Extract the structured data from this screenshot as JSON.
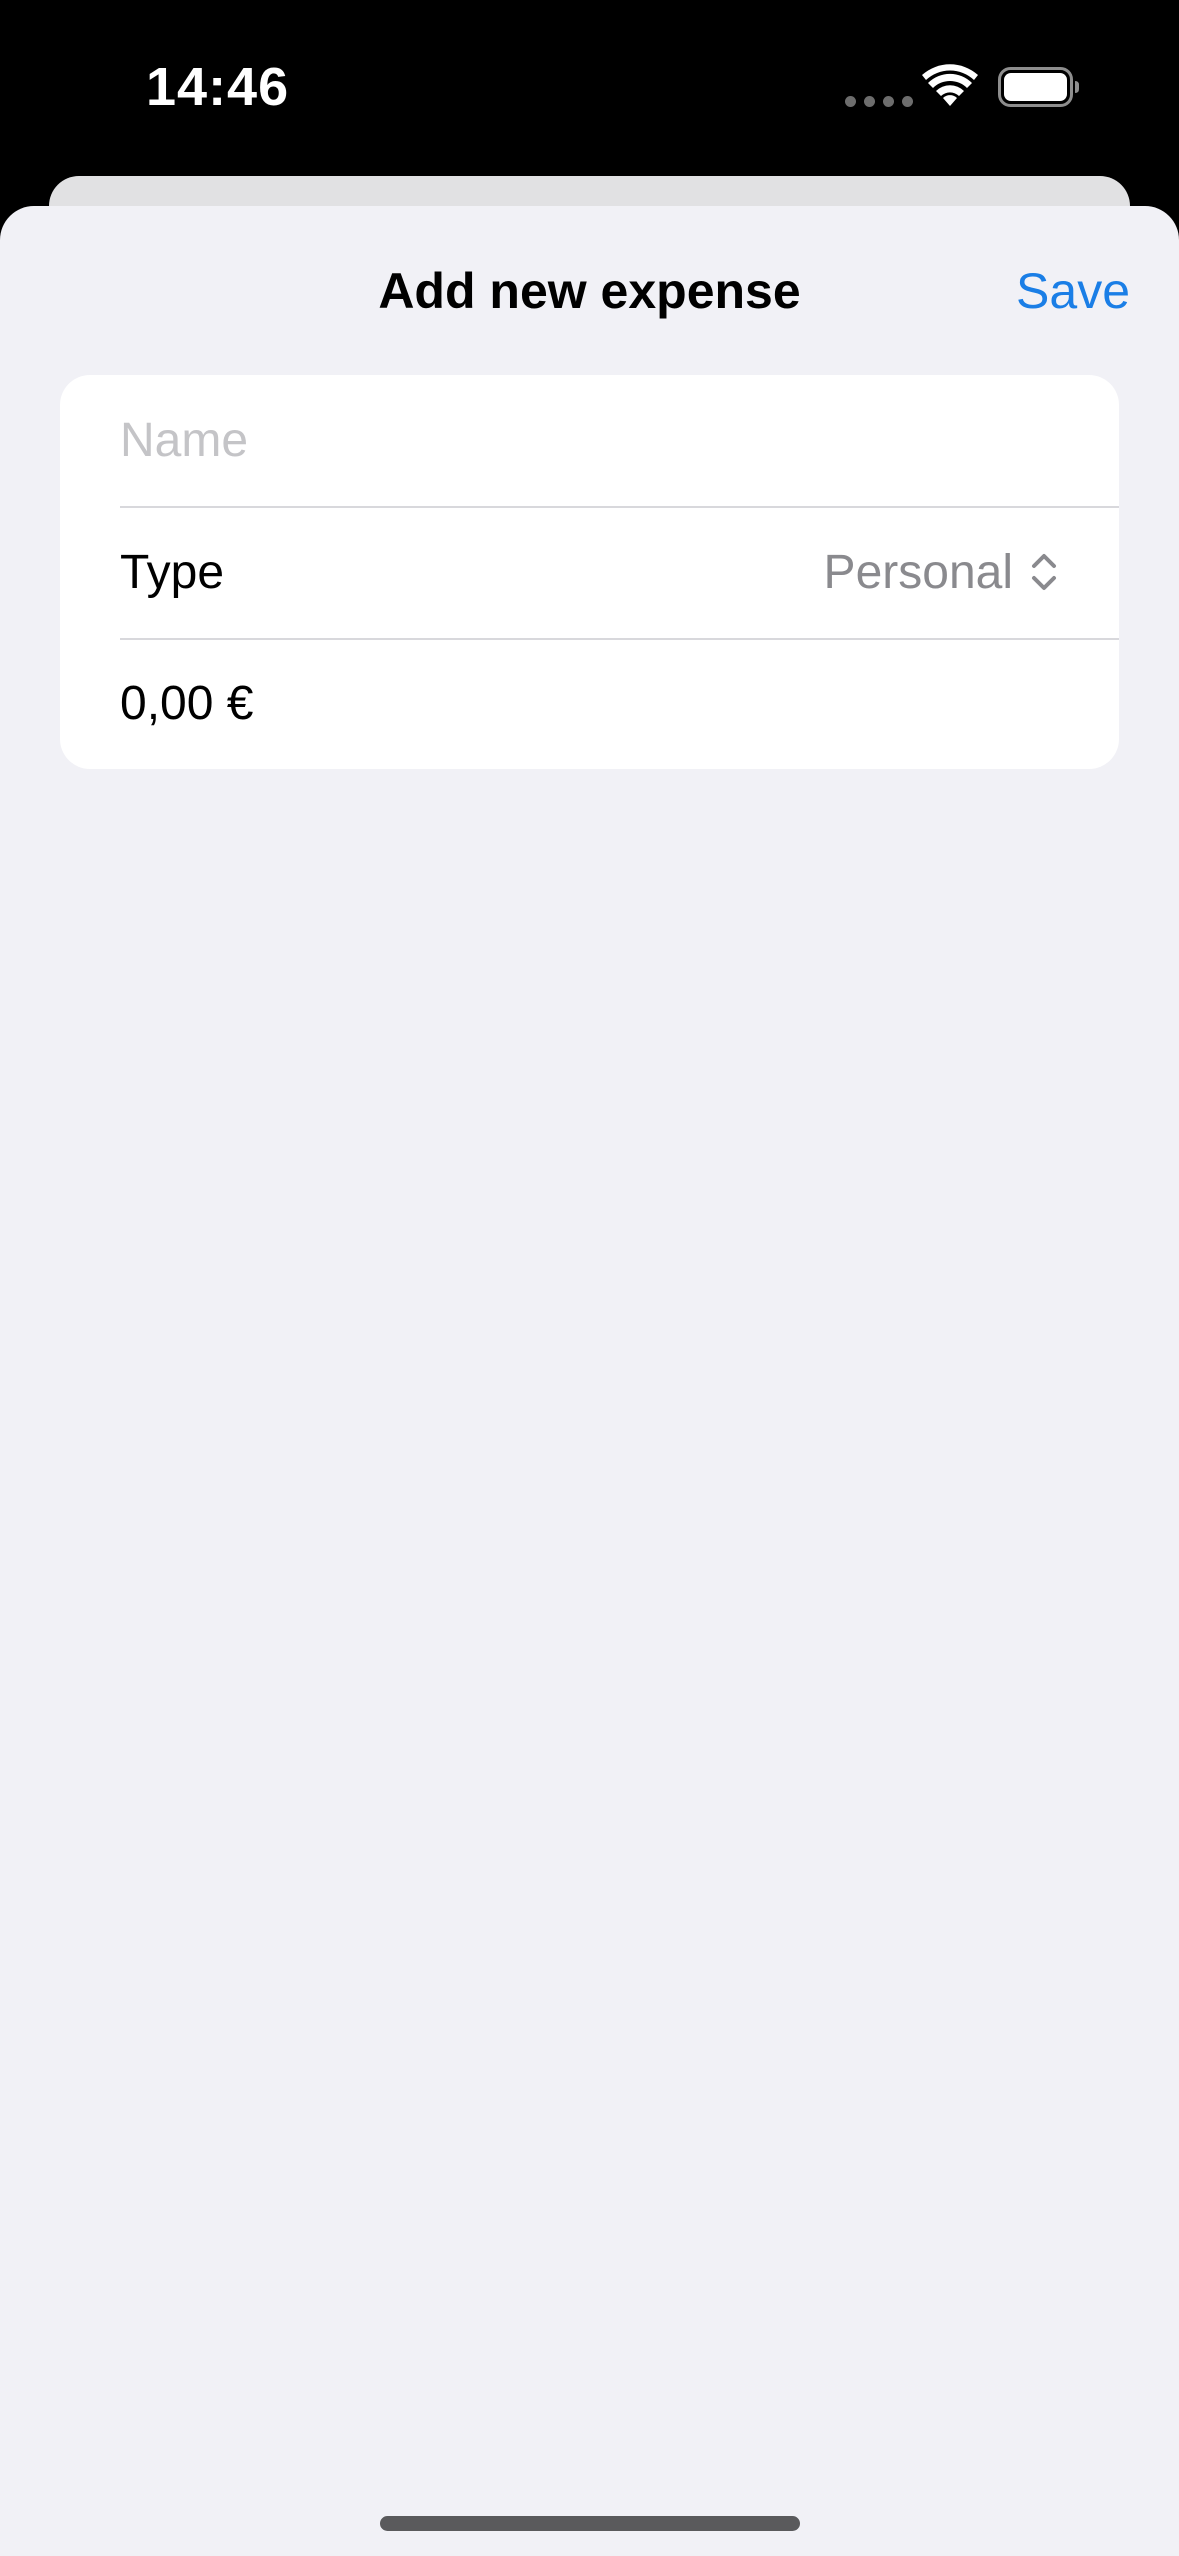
{
  "status_bar": {
    "time": "14:46",
    "icons": [
      "signal-dots-icon",
      "wifi-icon",
      "battery-icon"
    ]
  },
  "sheet": {
    "title": "Add new expense",
    "save_label": "Save"
  },
  "form": {
    "name": {
      "value": "",
      "placeholder": "Name"
    },
    "type": {
      "label": "Type",
      "selected": "Personal",
      "icon": "chevron-up-down-icon"
    },
    "amount": {
      "value": "0,00 €"
    }
  },
  "colors": {
    "accent": "#1a7ee6",
    "background": "#f1f1f6",
    "card": "#ffffff",
    "placeholder": "#c4c4c7",
    "secondary_text": "#8a8a8e"
  }
}
